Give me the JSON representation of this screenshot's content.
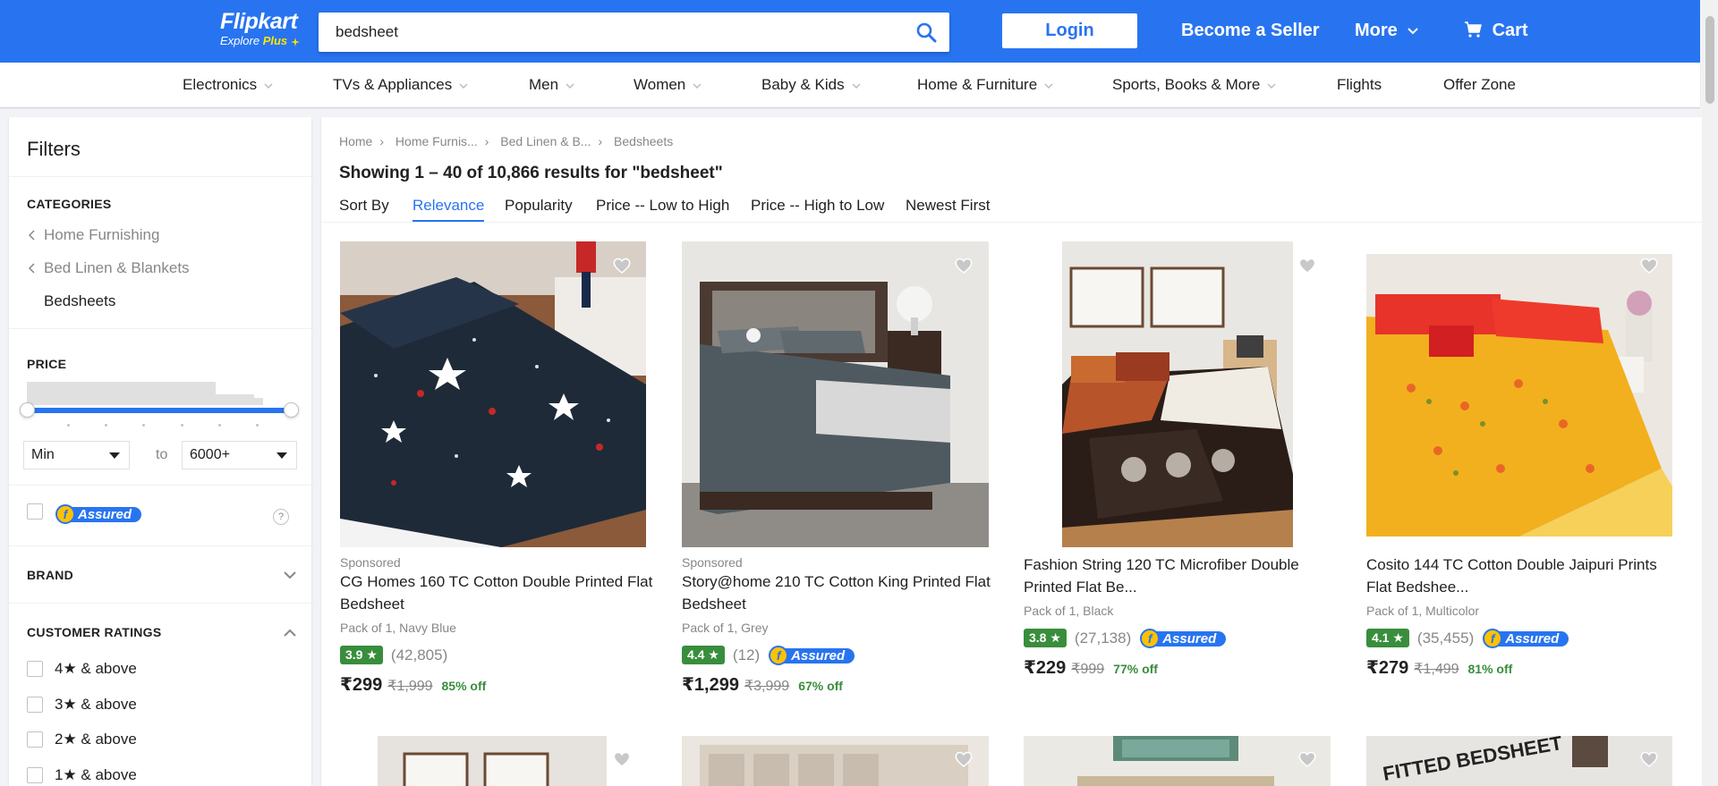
{
  "header": {
    "logo_name": "Flipkart",
    "logo_tagline": "Explore",
    "logo_plus": "Plus",
    "search_value": "bedsheet",
    "login_label": "Login",
    "seller_label": "Become a Seller",
    "more_label": "More",
    "cart_label": "Cart",
    "brand_color": "#2874f0"
  },
  "categories": [
    "Electronics",
    "TVs & Appliances",
    "Men",
    "Women",
    "Baby & Kids",
    "Home & Furniture",
    "Sports, Books & More",
    "Flights",
    "Offer Zone"
  ],
  "filters": {
    "title": "Filters",
    "categories_head": "CATEGORIES",
    "cat_items": [
      "Home Furnishing",
      "Bed Linen & Blankets",
      "Bedsheets"
    ],
    "price_head": "PRICE",
    "price_min": "Min",
    "price_to": "to",
    "price_max": "6000+",
    "assured_label": "Assured",
    "help_label": "?",
    "brand_head": "BRAND",
    "ratings_head": "CUSTOMER RATINGS",
    "ratings": [
      "4★ & above",
      "3★ & above",
      "2★ & above",
      "1★ & above"
    ]
  },
  "main": {
    "breadcrumbs": [
      "Home",
      "Home Furnis...",
      "Bed Linen & B...",
      "Bedsheets"
    ],
    "results_text": "Showing 1 – 40 of 10,866 results for \"bedsheet\"",
    "sort_by_label": "Sort By",
    "sort_options": [
      "Relevance",
      "Popularity",
      "Price -- Low to High",
      "Price -- High to Low",
      "Newest First"
    ],
    "active_sort": "Relevance"
  },
  "products": [
    {
      "sponsored": "Sponsored",
      "name": "CG Homes 160 TC Cotton Double Printed Flat Bedsheet",
      "meta": "Pack of 1, Navy Blue",
      "rating": "3.9",
      "count": "(42,805)",
      "assured": false,
      "price": "₹299",
      "mrp": "₹1,999",
      "off": "85% off"
    },
    {
      "sponsored": "Sponsored",
      "name": "Story@home 210 TC Cotton King Printed Flat Bedsheet",
      "meta": "Pack of 1, Grey",
      "rating": "4.4",
      "count": "(12)",
      "assured": true,
      "price": "₹1,299",
      "mrp": "₹3,999",
      "off": "67% off"
    },
    {
      "sponsored": "",
      "name": "Fashion String 120 TC Microfiber Double Printed Flat Be...",
      "meta": "Pack of 1, Black",
      "rating": "3.8",
      "count": "(27,138)",
      "assured": true,
      "price": "₹229",
      "mrp": "₹999",
      "off": "77% off"
    },
    {
      "sponsored": "",
      "name": "Cosito 144 TC Cotton Double Jaipuri Prints Flat Bedshee...",
      "meta": "Pack of 1, Multicolor",
      "rating": "4.1",
      "count": "(35,455)",
      "assured": true,
      "price": "₹279",
      "mrp": "₹1,499",
      "off": "81% off"
    }
  ],
  "second_row_labels": {
    "card4_text": "FITTED BEDSHEET"
  },
  "colors": {
    "rating_green": "#388e3c",
    "assured_yellow": "#ffc200",
    "muted_text": "#878787"
  }
}
